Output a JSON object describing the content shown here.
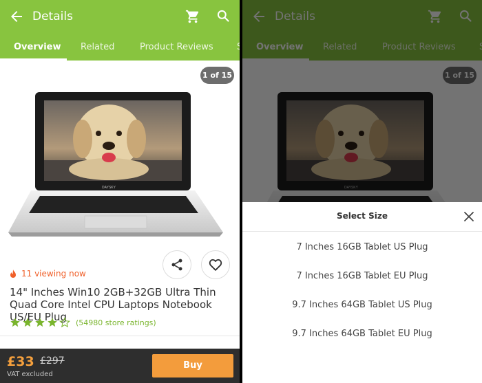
{
  "header": {
    "title": "Details",
    "tabs": [
      {
        "label": "Overview"
      },
      {
        "label": "Related"
      },
      {
        "label": "Product Reviews"
      },
      {
        "label": "S"
      }
    ]
  },
  "gallery": {
    "counter": "1 of 15",
    "laptop_brand": "DAYSKY"
  },
  "product": {
    "viewing": "11 viewing now",
    "title": "14\" Inches Win10 2GB+32GB Ultra Thin Quad Core Intel CPU Laptops Notebook US/EU Plug",
    "rating_stars": 4,
    "rating_max": 5,
    "ratings_text": "(54980 store ratings)"
  },
  "purchase": {
    "price": "£33",
    "old_price": "£297",
    "vat": "VAT excluded",
    "buy_label": "Buy"
  },
  "size_sheet": {
    "title": "Select Size",
    "options": [
      "7 Inches 16GB Tablet US Plug",
      "7 Inches 16GB Tablet EU Plug",
      "9.7 Inches 64GB Tablet US Plug",
      "9.7 Inches 64GB Tablet EU Plug"
    ]
  },
  "colors": {
    "brand_green": "#88c43f",
    "accent_orange": "#f39c3c",
    "star_green": "#7ab52e",
    "viewing_red": "#f0602a"
  }
}
